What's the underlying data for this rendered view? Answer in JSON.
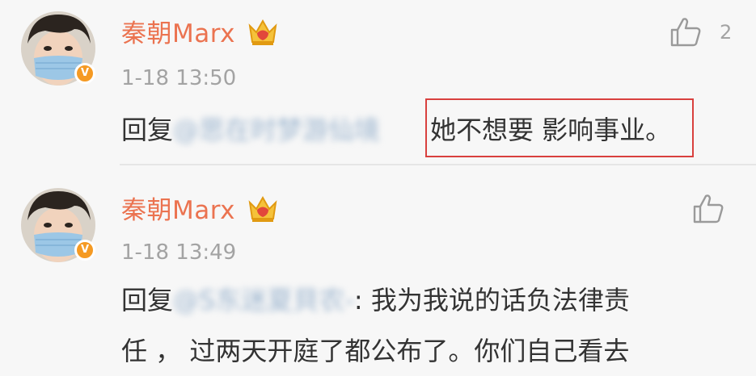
{
  "comments": [
    {
      "username": "秦朝Marx",
      "verified_badge": "V",
      "crown_icon": "vip-crown-icon",
      "time": "1-18 13:50",
      "like_icon": "thumbs-up-icon",
      "like_count": "2",
      "reply_prefix": "回复",
      "mention": "@思在时梦游仙境",
      "text": "她不想要 影响事业。",
      "highlight_color": "#d9403e"
    },
    {
      "username": "秦朝Marx",
      "verified_badge": "V",
      "crown_icon": "vip-crown-icon",
      "time": "1-18 13:49",
      "like_icon": "thumbs-up-icon",
      "reply_prefix": "回复",
      "mention": "@S东迷夏貝农-",
      "text_line1": ": 我为我说的话负法律责",
      "text_line2": "任 ， 过两天开庭了都公布了。你们自己看去"
    }
  ],
  "colors": {
    "username": "#eb7350",
    "mention": "#9cb5cf",
    "timestamp": "#a3a3a3",
    "badge": "#f59a23"
  }
}
